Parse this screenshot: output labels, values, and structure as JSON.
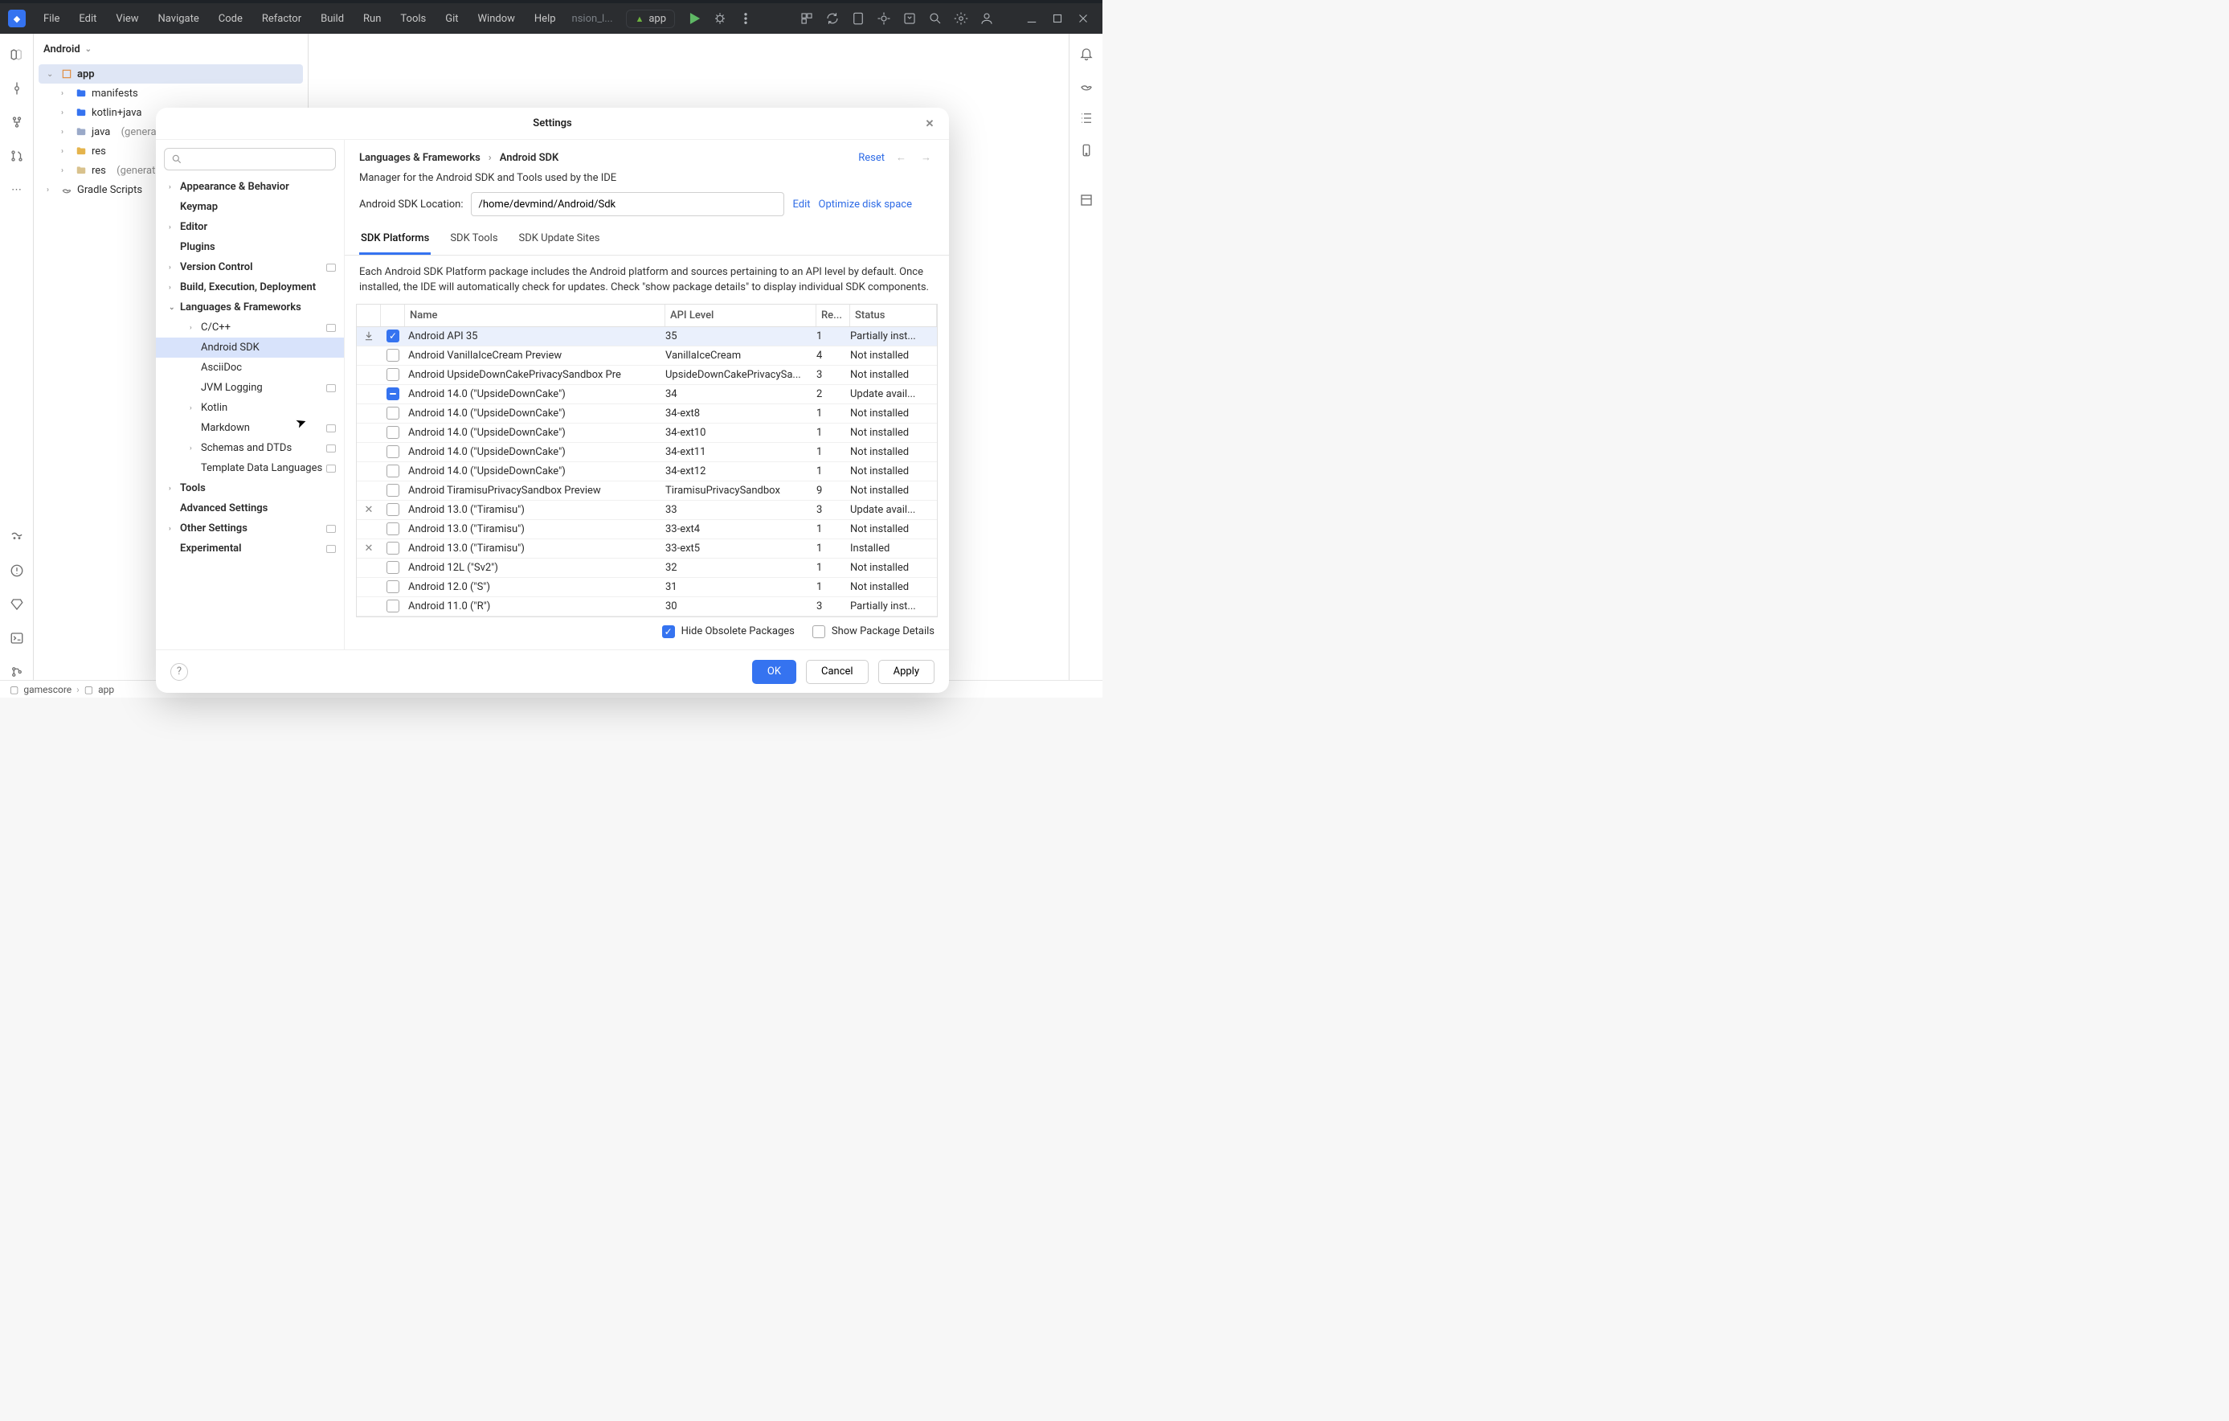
{
  "menu": {
    "items": [
      "File",
      "Edit",
      "View",
      "Navigate",
      "Code",
      "Refactor",
      "Build",
      "Run",
      "Tools",
      "Git",
      "Window",
      "Help"
    ],
    "hist": "nsion_l...",
    "runcfg": "app"
  },
  "project": {
    "title": "Android",
    "tree": {
      "root": "app",
      "children": [
        {
          "label": "manifests",
          "type": "folder"
        },
        {
          "label": "kotlin+java",
          "type": "folder"
        },
        {
          "label": "java",
          "suffix": "(generat",
          "type": "folder"
        },
        {
          "label": "res",
          "type": "res"
        },
        {
          "label": "res",
          "suffix": "(generate",
          "type": "res"
        }
      ],
      "sibling": "Gradle Scripts"
    }
  },
  "breadcrumb": {
    "root": "gamescore",
    "leaf": "app"
  },
  "settings": {
    "title": "Settings",
    "nav": {
      "group": "Languages & Frameworks",
      "leaf": "Android SDK",
      "reset": "Reset"
    },
    "desc": "Manager for the Android SDK and Tools used by the IDE",
    "loc": {
      "label": "Android SDK Location:",
      "value": "/home/devmind/Android/Sdk",
      "edit": "Edit",
      "opt": "Optimize disk space"
    },
    "tabs": [
      "SDK Platforms",
      "SDK Tools",
      "SDK Update Sites"
    ],
    "info": "Each Android SDK Platform package includes the Android platform and sources pertaining to an API level by default. Once installed, the IDE will automatically check for updates. Check \"show package details\" to display individual SDK components.",
    "cols": {
      "name": "Name",
      "api": "API Level",
      "rev": "Re...",
      "status": "Status"
    },
    "rows": [
      {
        "act": "dl",
        "chk": "checked",
        "name": "Android API 35",
        "api": "35",
        "rev": "1",
        "status": "Partially inst...",
        "sel": true
      },
      {
        "act": "",
        "chk": "",
        "name": "Android VanillaIceCream Preview",
        "api": "VanillaIceCream",
        "rev": "4",
        "status": "Not installed"
      },
      {
        "act": "",
        "chk": "",
        "name": "Android UpsideDownCakePrivacySandbox Pre",
        "api": "UpsideDownCakePrivacySa...",
        "rev": "3",
        "status": "Not installed"
      },
      {
        "act": "",
        "chk": "indet",
        "name": "Android 14.0 (\"UpsideDownCake\")",
        "api": "34",
        "rev": "2",
        "status": "Update avail..."
      },
      {
        "act": "",
        "chk": "",
        "name": "Android 14.0 (\"UpsideDownCake\")",
        "api": "34-ext8",
        "rev": "1",
        "status": "Not installed"
      },
      {
        "act": "",
        "chk": "",
        "name": "Android 14.0 (\"UpsideDownCake\")",
        "api": "34-ext10",
        "rev": "1",
        "status": "Not installed"
      },
      {
        "act": "",
        "chk": "",
        "name": "Android 14.0 (\"UpsideDownCake\")",
        "api": "34-ext11",
        "rev": "1",
        "status": "Not installed"
      },
      {
        "act": "",
        "chk": "",
        "name": "Android 14.0 (\"UpsideDownCake\")",
        "api": "34-ext12",
        "rev": "1",
        "status": "Not installed"
      },
      {
        "act": "",
        "chk": "",
        "name": "Android TiramisuPrivacySandbox Preview",
        "api": "TiramisuPrivacySandbox",
        "rev": "9",
        "status": "Not installed"
      },
      {
        "act": "x",
        "chk": "",
        "name": "Android 13.0 (\"Tiramisu\")",
        "api": "33",
        "rev": "3",
        "status": "Update avail..."
      },
      {
        "act": "",
        "chk": "",
        "name": "Android 13.0 (\"Tiramisu\")",
        "api": "33-ext4",
        "rev": "1",
        "status": "Not installed"
      },
      {
        "act": "x",
        "chk": "",
        "name": "Android 13.0 (\"Tiramisu\")",
        "api": "33-ext5",
        "rev": "1",
        "status": "Installed"
      },
      {
        "act": "",
        "chk": "",
        "name": "Android 12L (\"Sv2\")",
        "api": "32",
        "rev": "1",
        "status": "Not installed"
      },
      {
        "act": "",
        "chk": "",
        "name": "Android 12.0 (\"S\")",
        "api": "31",
        "rev": "1",
        "status": "Not installed"
      },
      {
        "act": "",
        "chk": "",
        "name": "Android 11.0 (\"R\")",
        "api": "30",
        "rev": "3",
        "status": "Partially inst..."
      }
    ],
    "opts": {
      "hide": "Hide Obsolete Packages",
      "details": "Show Package Details"
    },
    "buttons": {
      "ok": "OK",
      "cancel": "Cancel",
      "apply": "Apply"
    },
    "sideTree": [
      {
        "label": "Appearance & Behavior",
        "bold": true,
        "chev": true
      },
      {
        "label": "Keymap",
        "bold": true
      },
      {
        "label": "Editor",
        "bold": true,
        "chev": true
      },
      {
        "label": "Plugins",
        "bold": true
      },
      {
        "label": "Version Control",
        "bold": true,
        "chev": true,
        "opt": true
      },
      {
        "label": "Build, Execution, Deployment",
        "bold": true,
        "chev": true
      },
      {
        "label": "Languages & Frameworks",
        "bold": true,
        "chev": true,
        "open": true
      },
      {
        "label": "C/C++",
        "sub": true,
        "chev": true,
        "opt": true
      },
      {
        "label": "Android SDK",
        "sub": true,
        "sel": true
      },
      {
        "label": "AsciiDoc",
        "sub": true
      },
      {
        "label": "JVM Logging",
        "sub": true,
        "opt": true
      },
      {
        "label": "Kotlin",
        "sub": true,
        "chev": true
      },
      {
        "label": "Markdown",
        "sub": true,
        "opt": true
      },
      {
        "label": "Schemas and DTDs",
        "sub": true,
        "chev": true,
        "opt": true
      },
      {
        "label": "Template Data Languages",
        "sub": true,
        "opt": true
      },
      {
        "label": "Tools",
        "bold": true,
        "chev": true
      },
      {
        "label": "Advanced Settings",
        "bold": true
      },
      {
        "label": "Other Settings",
        "bold": true,
        "chev": true,
        "opt": true
      },
      {
        "label": "Experimental",
        "bold": true,
        "opt": true
      }
    ]
  }
}
